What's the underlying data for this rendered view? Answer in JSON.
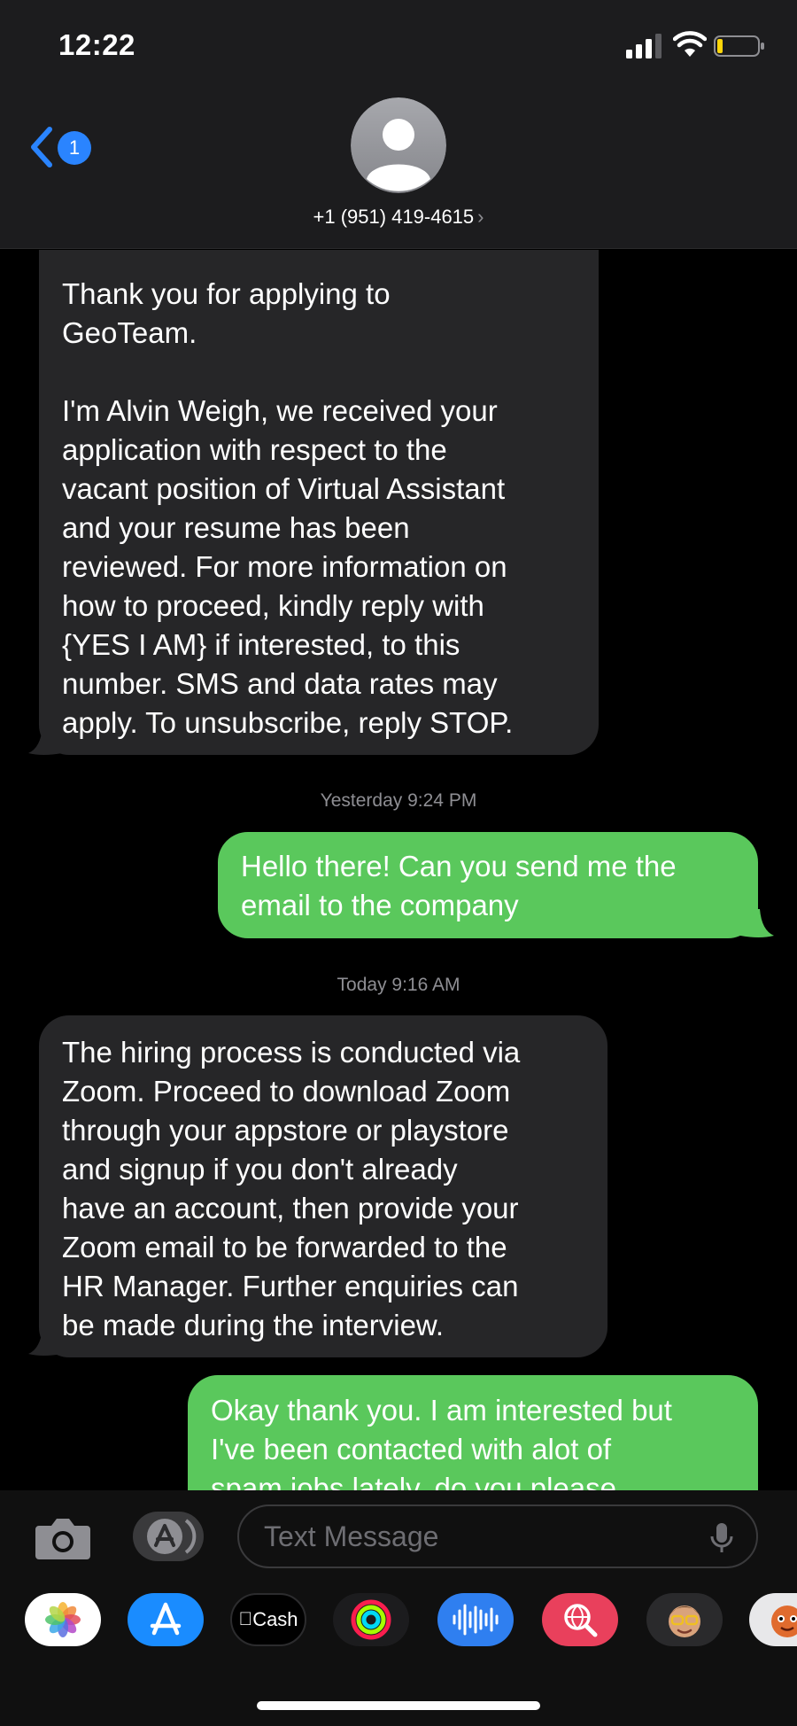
{
  "status": {
    "time": "12:22"
  },
  "header": {
    "back_badge": "1",
    "contact_number": "+1 (951) 419-4615",
    "chevron": "›"
  },
  "messages": [
    {
      "direction": "received",
      "lines": [
        "Thank you for applying to",
        "GeoTeam.",
        "",
        "I'm Alvin Weigh, we received your",
        "application with respect to the",
        "vacant position of Virtual Assistant",
        "and your resume has been",
        "reviewed. For more information on",
        "how to proceed, kindly reply with",
        "{YES I AM} if interested, to this",
        "number. SMS and data rates may",
        "apply. To unsubscribe, reply STOP."
      ]
    },
    {
      "direction": "timestamp",
      "text": "Yesterday 9:24 PM"
    },
    {
      "direction": "sent",
      "lines": [
        "Hello there! Can you send me the",
        "email to the company"
      ]
    },
    {
      "direction": "timestamp",
      "text": "Today 9:16 AM"
    },
    {
      "direction": "received",
      "lines": [
        "The hiring process is conducted via",
        "Zoom. Proceed to download Zoom",
        "through your appstore or playstore",
        "and signup if you don't already",
        "have an account, then provide your",
        "Zoom email to be forwarded to the",
        "HR Manager. Further enquiries can",
        "be made during the interview."
      ]
    },
    {
      "direction": "sent",
      "lines": [
        "Okay thank you. I am interested but",
        "I've been contacted with alot of",
        "spam jobs lately, do you please"
      ]
    }
  ],
  "input": {
    "placeholder": "Text Message"
  },
  "app_drawer": {
    "cash_label": "Cash",
    "apps": [
      "photos-icon",
      "app-store-icon",
      "apple-cash-icon",
      "activity-icon",
      "audio-message-icon",
      "web-search-icon",
      "memoji-icon",
      "animoji-icon"
    ]
  },
  "colors": {
    "sent_bubble": "#5ac85c",
    "received_bubble": "#262628",
    "accent_blue": "#2a84ff"
  }
}
